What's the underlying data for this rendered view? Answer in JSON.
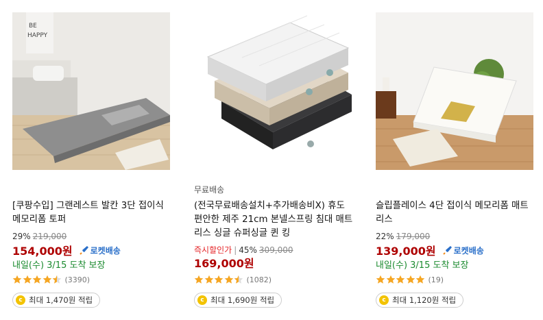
{
  "products": [
    {
      "subtag": "",
      "title": "[쿠팡수입] 그랜레스트 발칸 3단 접이식 메모리폼 토퍼",
      "discount": "29%",
      "original_price": "219,000",
      "instant_label": "",
      "price": "154,000원",
      "rocket_label": "로켓배송",
      "delivery": "내일(수) 3/15 도착 보장",
      "rating_stars": 4.5,
      "review_count": "(3390)",
      "reward": "최대 1,470원 적립",
      "coin_symbol": "c"
    },
    {
      "subtag": "무료배송",
      "title": "(전국무료배송설치+추가배송비X) 휴도 편안한 제주 21cm 본넬스프링 침대 매트리스 싱글 슈퍼싱글 퀸 킹",
      "discount": "45%",
      "original_price": "309,000",
      "instant_label": "즉시할인가",
      "price": "169,000원",
      "rocket_label": "",
      "delivery": "",
      "rating_stars": 4.5,
      "review_count": "(1082)",
      "reward": "최대 1,690원 적립",
      "coin_symbol": "c"
    },
    {
      "subtag": "",
      "title": "슬립플레이스 4단 접이식 메모리폼 매트리스",
      "discount": "22%",
      "original_price": "179,000",
      "instant_label": "",
      "price": "139,000원",
      "rocket_label": "로켓배송",
      "delivery": "내일(수) 3/15 도착 보장",
      "rating_stars": 5,
      "review_count": "(19)",
      "reward": "최대 1,120원 적립",
      "coin_symbol": "c"
    }
  ],
  "image_text": {
    "poster": "BE HAPPY"
  },
  "colors": {
    "price": "#ae0000",
    "rocket": "#2a6fc9",
    "delivery": "#1a8a2e",
    "star": "#f5a623",
    "coin": "#f3c300"
  }
}
